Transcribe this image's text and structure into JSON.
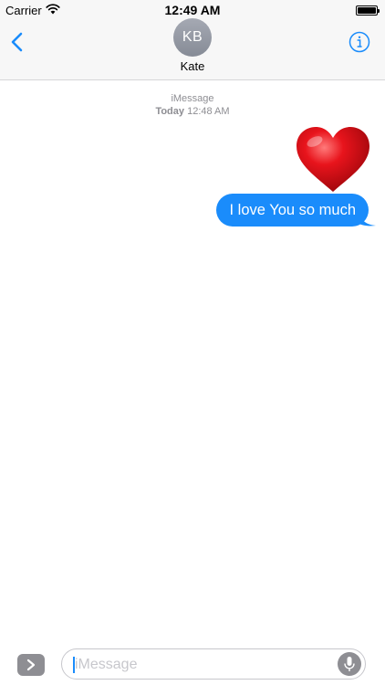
{
  "status_bar": {
    "carrier": "Carrier",
    "time": "12:49 AM",
    "battery_level": 1.0
  },
  "header": {
    "back_icon": "chevron-left-icon",
    "avatar_initials": "KB",
    "contact_name": "Kate",
    "info_icon": "info-circle-icon"
  },
  "conversation": {
    "service": "iMessage",
    "timestamp_day": "Today",
    "timestamp_time": "12:48 AM",
    "sticker": "heart-icon",
    "messages": [
      {
        "from": "me",
        "text": "I love You so much",
        "color": "#1a8cfb"
      }
    ]
  },
  "input_bar": {
    "apps_icon": "chevron-right-icon",
    "placeholder": "iMessage",
    "mic_icon": "microphone-icon"
  },
  "colors": {
    "accent": "#1a8cfb",
    "bubble": "#1a8cfb",
    "heart": "#e0141b",
    "secondary_text": "#8e8e93"
  }
}
